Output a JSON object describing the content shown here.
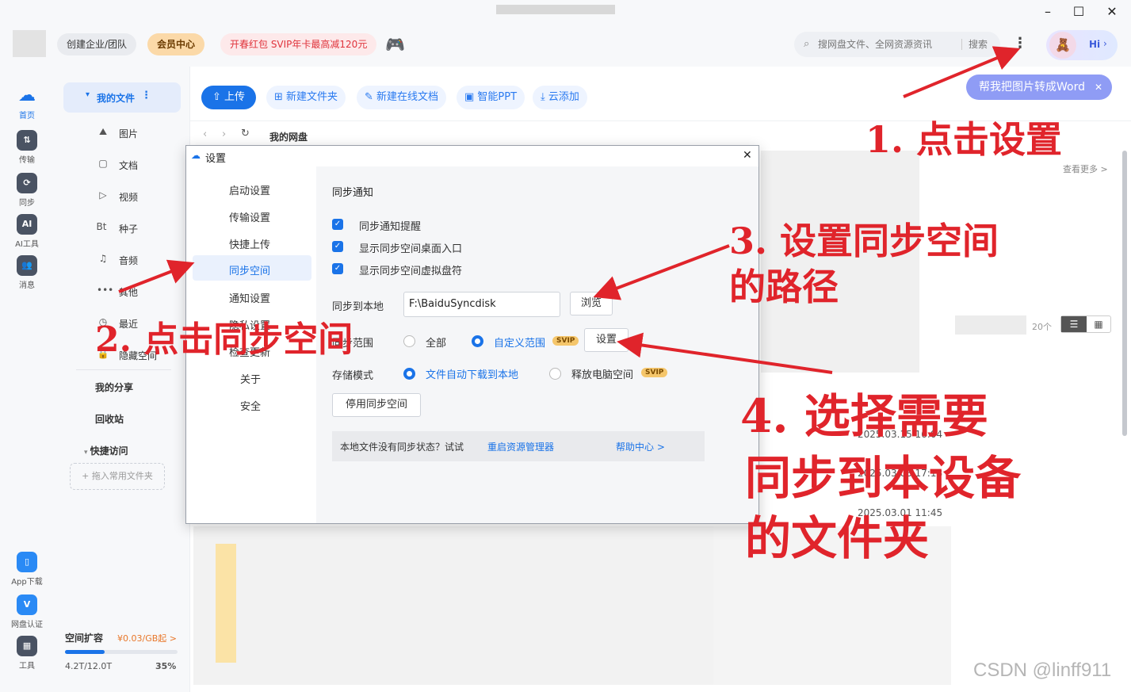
{
  "topbar": {
    "create_enterprise": "创建企业/团队",
    "vip_center": "会员中心",
    "promo": "开春红包 SVIP年卡最高减120元",
    "search_placeholder": "搜网盘文件、全网资源资讯",
    "search_button": "搜索",
    "hi": "Hi",
    "convert_banner": "帮我把图片转成Word"
  },
  "rail": {
    "items": [
      "首页",
      "传输",
      "同步",
      "AI工具",
      "消息"
    ],
    "bottom": [
      "App下载",
      "网盘认证",
      "工具"
    ]
  },
  "nav": {
    "my_files": "我的文件",
    "items": [
      "图片",
      "文档",
      "视频",
      "种子",
      "音频",
      "其他",
      "最近",
      "隐藏空间"
    ],
    "torrent_icon": "Bt",
    "share": "我的分享",
    "recycle": "回收站",
    "quick_access": "快捷访问",
    "drag_hint": "+ 拖入常用文件夹",
    "storage_label": "空间扩容",
    "storage_price": "¥0.03/GB起 >",
    "storage_used": "4.2T/12.0T",
    "storage_pct": "35%",
    "storage_fraction": 0.35
  },
  "toolbar": {
    "upload": "上传",
    "new_folder": "新建文件夹",
    "new_doc": "新建在线文档",
    "smart_ppt": "智能PPT",
    "cloud_add": "云添加",
    "breadcrumb": "我的网盘",
    "see_more": "查看更多 >",
    "count": "20个"
  },
  "dialog": {
    "title": "设置",
    "nav": [
      "启动设置",
      "传输设置",
      "快捷上传",
      "同步空间",
      "通知设置",
      "隐私设置",
      "检查更新",
      "关于",
      "安全"
    ],
    "section_title": "同步通知",
    "checks": [
      "同步通知提醒",
      "显示同步空间桌面入口",
      "显示同步空间虚拟盘符"
    ],
    "local_label": "同步到本地",
    "local_path": "F:\\BaiduSyncdisk",
    "browse": "浏览",
    "range_label": "同步范围",
    "range_all": "全部",
    "range_custom": "自定义范围",
    "svip": "SVIP",
    "set_button": "设置",
    "storage_mode_label": "存储模式",
    "mode_auto": "文件自动下载到本地",
    "mode_free": "释放电脑空间",
    "disable_button": "停用同步空间",
    "info_text": "本地文件没有同步状态？试试",
    "info_link": "重启资源管理器",
    "help_link": "帮助中心 >"
  },
  "files": {
    "dates": [
      "2025.03.15 16:04",
      "2025.03.08 17:18",
      "2025.03.01 11:45"
    ]
  },
  "annotations": {
    "step1": "1. 点击设置",
    "step2": "2. 点击同步空间",
    "step3_line1": "3. 设置同步空间",
    "step3_line2": "的路径",
    "step4_line1": "4. 选择需要",
    "step4_line2": "同步到本设备",
    "step4_line3": "的文件夹"
  },
  "watermark": "CSDN @linff911",
  "colors": {
    "accent": "#1a73e8",
    "annotation": "#e0242b",
    "svip": "#f5c66b"
  }
}
